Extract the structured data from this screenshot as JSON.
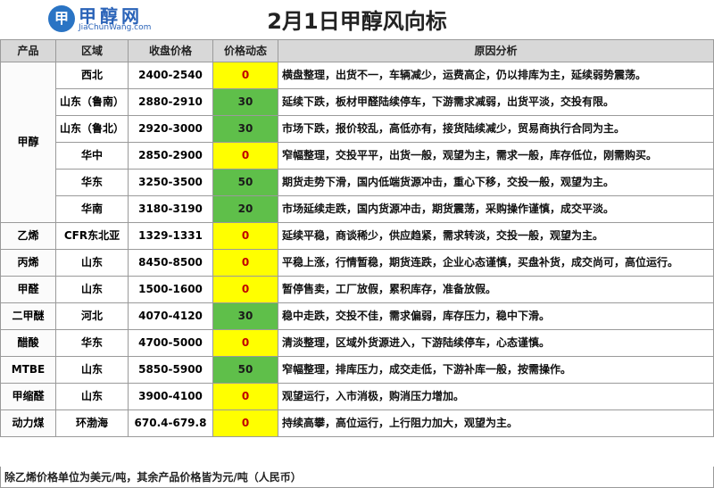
{
  "logo": {
    "cn": "甲醇网",
    "url": "JiaChunWang.com",
    "mark": "甲"
  },
  "title": "2月1日甲醇风向标",
  "columns": [
    "产品",
    "区域",
    "收盘价格",
    "价格动态",
    "原因分析"
  ],
  "groups": [
    {
      "product": "甲醇",
      "rows": [
        {
          "region": "西北",
          "price": "2400-2540",
          "dyn": "0",
          "reason": "横盘整理，出货不一，车辆减少，运费高企，仍以排库为主，延续弱势震荡。"
        },
        {
          "region": "山东（鲁南）",
          "price": "2880-2910",
          "dyn": "30",
          "reason": "延续下跌，板材甲醛陆续停车，下游需求减弱，出货平淡，交投有限。"
        },
        {
          "region": "山东（鲁北）",
          "price": "2920-3000",
          "dyn": "30",
          "reason": "市场下跌，报价较乱，高低亦有，接货陆续减少，贸易商执行合同为主。"
        },
        {
          "region": "华中",
          "price": "2850-2900",
          "dyn": "0",
          "reason": "窄幅整理，交投平平，出货一般，观望为主，需求一般，库存低位，刚需购买。"
        },
        {
          "region": "华东",
          "price": "3250-3500",
          "dyn": "50",
          "reason": "期货走势下滑，国内低端货源冲击，重心下移，交投一般，观望为主。"
        },
        {
          "region": "华南",
          "price": "3180-3190",
          "dyn": "20",
          "reason": "市场延续走跌，国内货源冲击，期货震荡，采购操作谨慎，成交平淡。"
        }
      ]
    },
    {
      "product": "乙烯",
      "rows": [
        {
          "region": "CFR东北亚",
          "price": "1329-1331",
          "dyn": "0",
          "reason": "延续平稳，商谈稀少，供应趋紧，需求转淡，交投一般，观望为主。"
        }
      ]
    },
    {
      "product": "丙烯",
      "rows": [
        {
          "region": "山东",
          "price": "8450-8500",
          "dyn": "0",
          "reason": "平稳上涨，行情暂稳，期货连跌，企业心态谨慎，买盘补货，成交尚可，高位运行。"
        }
      ]
    },
    {
      "product": "甲醛",
      "rows": [
        {
          "region": "山东",
          "price": "1500-1600",
          "dyn": "0",
          "reason": "暂停售卖，工厂放假，累积库存，准备放假。"
        }
      ]
    },
    {
      "product": "二甲醚",
      "rows": [
        {
          "region": "河北",
          "price": "4070-4120",
          "dyn": "30",
          "reason": "稳中走跌，交投不佳，需求偏弱，库存压力，稳中下滑。"
        }
      ]
    },
    {
      "product": "醋酸",
      "rows": [
        {
          "region": "华东",
          "price": "4700-5000",
          "dyn": "0",
          "reason": "清淡整理，区域外货源进入，下游陆续停车，心态谨慎。"
        }
      ]
    },
    {
      "product": "MTBE",
      "rows": [
        {
          "region": "山东",
          "price": "5850-5900",
          "dyn": "50",
          "reason": "窄幅整理，排库压力，成交走低，下游补库一般，按需操作。"
        }
      ]
    },
    {
      "product": "甲缩醛",
      "rows": [
        {
          "region": "山东",
          "price": "3900-4100",
          "dyn": "0",
          "reason": "观望运行，入市消极，购消压力增加。"
        }
      ]
    },
    {
      "product": "动力煤",
      "rows": [
        {
          "region": "环渤海",
          "price": "670.4-679.8",
          "dyn": "0",
          "reason": "持续高攀，高位运行，上行阻力加大，观望为主。"
        }
      ]
    }
  ],
  "footer": "除乙烯价格单位为美元/吨，其余产品价格皆为元/吨（人民币）",
  "colors": {
    "yellow": "#ffff00",
    "green": "#5fbf4a",
    "header": "#d8d8d8"
  }
}
